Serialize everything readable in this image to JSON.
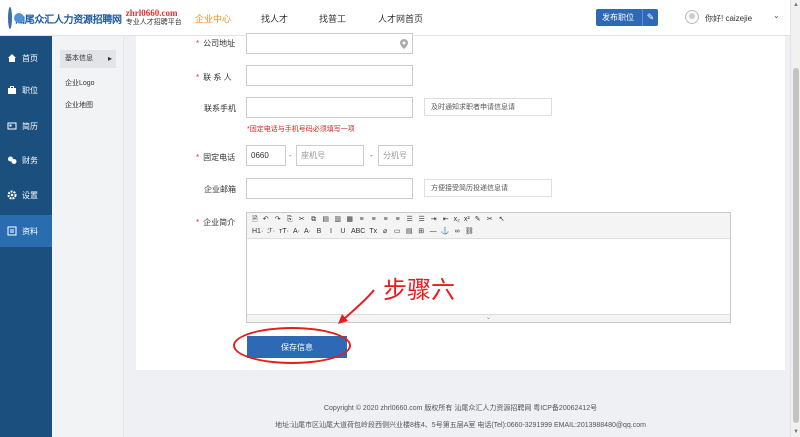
{
  "header": {
    "logo_name": "汕尾众汇人力资源招聘网",
    "logo_domain": "zhrl0660.com",
    "logo_slogan": "专业人才招聘平台",
    "nav": [
      "企业中心",
      "找人才",
      "找普工",
      "人才网首页"
    ],
    "publish_label": "发布职位",
    "greeting": "你好! caizejie"
  },
  "sidebar": {
    "items": [
      {
        "label": "首页",
        "icon": "home-icon"
      },
      {
        "label": "职位",
        "icon": "briefcase-icon"
      },
      {
        "label": "简历",
        "icon": "resume-icon"
      },
      {
        "label": "财务",
        "icon": "finance-icon"
      },
      {
        "label": "设置",
        "icon": "gear-icon"
      },
      {
        "label": "资料",
        "icon": "profile-icon"
      }
    ],
    "active": "资料"
  },
  "submenu": {
    "items": [
      "基本信息",
      "企业Logo",
      "企业地图"
    ],
    "active": "基本信息"
  },
  "form": {
    "address_label": "公司地址",
    "contact_label": "联 系 人",
    "mobile_label": "联系手机",
    "mobile_hint": "及时通知求职者申请信息请",
    "phone_note": "*固定电话与手机号码必须填写一项",
    "landline_label": "固定电话",
    "area_code": "0660",
    "landline_placeholder": "座机号",
    "ext_placeholder": "分机号",
    "email_label": "企业邮箱",
    "email_hint": "方便接受简历投递信息请",
    "intro_label": "企业简介",
    "save_label": "保存信息"
  },
  "editor": {
    "row1": [
      "🗎",
      "↶",
      "↷",
      "⎘",
      "✂",
      "⧉",
      "▤",
      "▥",
      "▦",
      "≡",
      "≡",
      "≡",
      "≡",
      "☰",
      "☰",
      "⇥",
      "⇤",
      "x₂",
      "x²",
      "✎",
      "✂",
      "↖"
    ],
    "row2": [
      "H1·",
      "ℱ·",
      "тT·",
      "A·",
      "A·",
      "B",
      "I",
      "U",
      "ABC",
      "Tx",
      "⌀",
      "▭",
      "▤",
      "⊞",
      "—",
      "⚓",
      "∞",
      "⛓"
    ]
  },
  "annotation": "步骤六",
  "footer": {
    "copyright": "Copyright © 2020 zhrl0660.com 版权所有 汕尾众汇人力资源招聘网 粤ICP备20062412号",
    "address": "地址:汕尾市区汕尾大道荷包岭段西侧兴业楼8栋4、5号第五层A室 电话(Tel):0660-3291999 EMAIL:2013988480@qq.com"
  },
  "colors": {
    "brand_blue": "#2d69b4",
    "sidebar_blue": "#1a4f7e",
    "nav_active": "#f08c1c",
    "annotation_red": "#e41d1d"
  }
}
